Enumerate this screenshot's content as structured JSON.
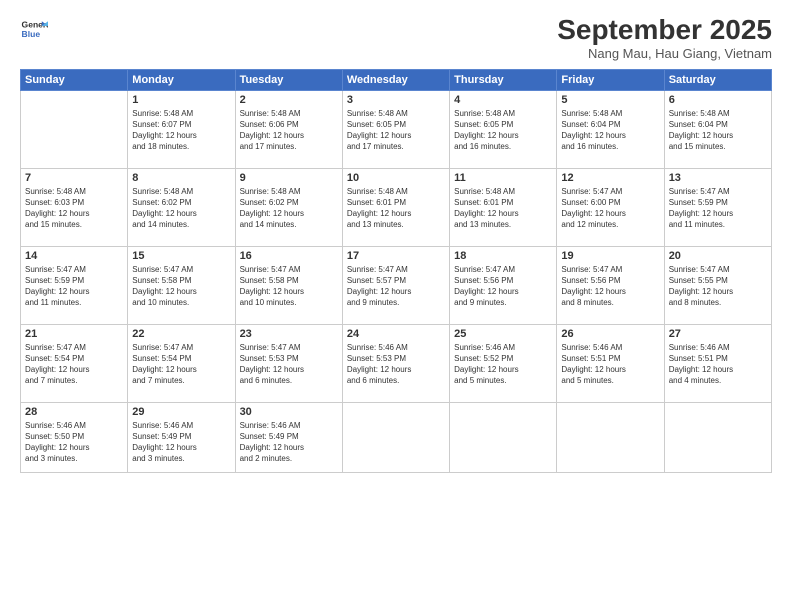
{
  "logo": {
    "line1": "General",
    "line2": "Blue"
  },
  "title": "September 2025",
  "subtitle": "Nang Mau, Hau Giang, Vietnam",
  "days_of_week": [
    "Sunday",
    "Monday",
    "Tuesday",
    "Wednesday",
    "Thursday",
    "Friday",
    "Saturday"
  ],
  "weeks": [
    [
      {
        "day": "",
        "info": ""
      },
      {
        "day": "1",
        "info": "Sunrise: 5:48 AM\nSunset: 6:07 PM\nDaylight: 12 hours\nand 18 minutes."
      },
      {
        "day": "2",
        "info": "Sunrise: 5:48 AM\nSunset: 6:06 PM\nDaylight: 12 hours\nand 17 minutes."
      },
      {
        "day": "3",
        "info": "Sunrise: 5:48 AM\nSunset: 6:05 PM\nDaylight: 12 hours\nand 17 minutes."
      },
      {
        "day": "4",
        "info": "Sunrise: 5:48 AM\nSunset: 6:05 PM\nDaylight: 12 hours\nand 16 minutes."
      },
      {
        "day": "5",
        "info": "Sunrise: 5:48 AM\nSunset: 6:04 PM\nDaylight: 12 hours\nand 16 minutes."
      },
      {
        "day": "6",
        "info": "Sunrise: 5:48 AM\nSunset: 6:04 PM\nDaylight: 12 hours\nand 15 minutes."
      }
    ],
    [
      {
        "day": "7",
        "info": "Sunrise: 5:48 AM\nSunset: 6:03 PM\nDaylight: 12 hours\nand 15 minutes."
      },
      {
        "day": "8",
        "info": "Sunrise: 5:48 AM\nSunset: 6:02 PM\nDaylight: 12 hours\nand 14 minutes."
      },
      {
        "day": "9",
        "info": "Sunrise: 5:48 AM\nSunset: 6:02 PM\nDaylight: 12 hours\nand 14 minutes."
      },
      {
        "day": "10",
        "info": "Sunrise: 5:48 AM\nSunset: 6:01 PM\nDaylight: 12 hours\nand 13 minutes."
      },
      {
        "day": "11",
        "info": "Sunrise: 5:48 AM\nSunset: 6:01 PM\nDaylight: 12 hours\nand 13 minutes."
      },
      {
        "day": "12",
        "info": "Sunrise: 5:47 AM\nSunset: 6:00 PM\nDaylight: 12 hours\nand 12 minutes."
      },
      {
        "day": "13",
        "info": "Sunrise: 5:47 AM\nSunset: 5:59 PM\nDaylight: 12 hours\nand 11 minutes."
      }
    ],
    [
      {
        "day": "14",
        "info": "Sunrise: 5:47 AM\nSunset: 5:59 PM\nDaylight: 12 hours\nand 11 minutes."
      },
      {
        "day": "15",
        "info": "Sunrise: 5:47 AM\nSunset: 5:58 PM\nDaylight: 12 hours\nand 10 minutes."
      },
      {
        "day": "16",
        "info": "Sunrise: 5:47 AM\nSunset: 5:58 PM\nDaylight: 12 hours\nand 10 minutes."
      },
      {
        "day": "17",
        "info": "Sunrise: 5:47 AM\nSunset: 5:57 PM\nDaylight: 12 hours\nand 9 minutes."
      },
      {
        "day": "18",
        "info": "Sunrise: 5:47 AM\nSunset: 5:56 PM\nDaylight: 12 hours\nand 9 minutes."
      },
      {
        "day": "19",
        "info": "Sunrise: 5:47 AM\nSunset: 5:56 PM\nDaylight: 12 hours\nand 8 minutes."
      },
      {
        "day": "20",
        "info": "Sunrise: 5:47 AM\nSunset: 5:55 PM\nDaylight: 12 hours\nand 8 minutes."
      }
    ],
    [
      {
        "day": "21",
        "info": "Sunrise: 5:47 AM\nSunset: 5:54 PM\nDaylight: 12 hours\nand 7 minutes."
      },
      {
        "day": "22",
        "info": "Sunrise: 5:47 AM\nSunset: 5:54 PM\nDaylight: 12 hours\nand 7 minutes."
      },
      {
        "day": "23",
        "info": "Sunrise: 5:47 AM\nSunset: 5:53 PM\nDaylight: 12 hours\nand 6 minutes."
      },
      {
        "day": "24",
        "info": "Sunrise: 5:46 AM\nSunset: 5:53 PM\nDaylight: 12 hours\nand 6 minutes."
      },
      {
        "day": "25",
        "info": "Sunrise: 5:46 AM\nSunset: 5:52 PM\nDaylight: 12 hours\nand 5 minutes."
      },
      {
        "day": "26",
        "info": "Sunrise: 5:46 AM\nSunset: 5:51 PM\nDaylight: 12 hours\nand 5 minutes."
      },
      {
        "day": "27",
        "info": "Sunrise: 5:46 AM\nSunset: 5:51 PM\nDaylight: 12 hours\nand 4 minutes."
      }
    ],
    [
      {
        "day": "28",
        "info": "Sunrise: 5:46 AM\nSunset: 5:50 PM\nDaylight: 12 hours\nand 3 minutes."
      },
      {
        "day": "29",
        "info": "Sunrise: 5:46 AM\nSunset: 5:49 PM\nDaylight: 12 hours\nand 3 minutes."
      },
      {
        "day": "30",
        "info": "Sunrise: 5:46 AM\nSunset: 5:49 PM\nDaylight: 12 hours\nand 2 minutes."
      },
      {
        "day": "",
        "info": ""
      },
      {
        "day": "",
        "info": ""
      },
      {
        "day": "",
        "info": ""
      },
      {
        "day": "",
        "info": ""
      }
    ]
  ]
}
